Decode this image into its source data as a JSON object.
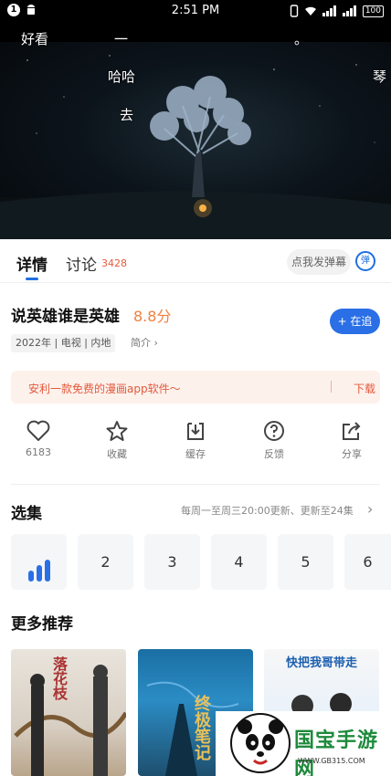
{
  "status_bar": {
    "time": "2:51 PM",
    "notif_badge": "1",
    "battery": "100"
  },
  "video": {
    "danmaku": [
      "好看",
      "一",
      "。",
      "哈哈",
      "琴",
      "去"
    ]
  },
  "tabs": {
    "detail": "详情",
    "discuss": "讨论",
    "discuss_count": "3428",
    "danmu_placeholder": "点我发弹幕",
    "danmu_icon_text": "弹"
  },
  "show": {
    "title": "说英雄谁是英雄",
    "score": "8.8分",
    "follow_label": "+ 在追",
    "meta": "2022年 | 电视 | 内地",
    "intro_label": "简介 ›"
  },
  "ad": {
    "text": "安利一款免费的漫画app软件〜",
    "download": "下载"
  },
  "actions": [
    {
      "label": "6183",
      "icon": "heart-icon"
    },
    {
      "label": "收藏",
      "icon": "star-icon"
    },
    {
      "label": "缓存",
      "icon": "download-icon"
    },
    {
      "label": "反馈",
      "icon": "question-icon"
    },
    {
      "label": "分享",
      "icon": "share-icon"
    }
  ],
  "episodes": {
    "title": "选集",
    "info": "每周一至周三20:00更新、更新至24集",
    "arrow": "›",
    "items": [
      "2",
      "3",
      "4",
      "5",
      "6"
    ]
  },
  "recommend": {
    "title": "更多推荐",
    "posters": [
      "落花枝",
      "终极笔记",
      "快把我哥带走"
    ]
  },
  "watermark": {
    "title": "国宝手游网",
    "url": "WWW.GB315.COM"
  },
  "colors": {
    "accent": "#2a6fe6",
    "score": "#f08040",
    "ad_text": "#e25a3c"
  }
}
